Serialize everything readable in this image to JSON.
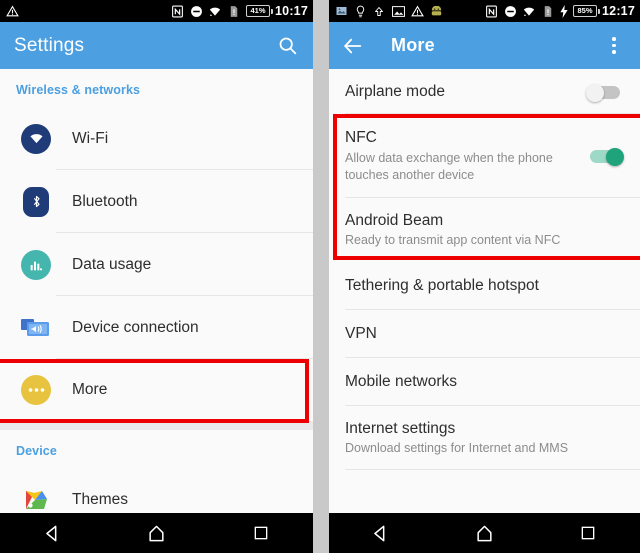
{
  "left_phone": {
    "status_bar": {
      "icons": [
        "warning-triangle-icon",
        "nfc-icon",
        "dnd-icon",
        "wifi-icon",
        "sim-alert-icon"
      ],
      "battery_percent": "41%",
      "clock": "10:17"
    },
    "app_bar": {
      "title": "Settings",
      "search_icon": "search-icon"
    },
    "sections": [
      {
        "header": "Wireless & networks",
        "items": [
          {
            "label": "Wi-Fi",
            "icon": "wifi-icon"
          },
          {
            "label": "Bluetooth",
            "icon": "bluetooth-icon"
          },
          {
            "label": "Data usage",
            "icon": "data-usage-icon"
          },
          {
            "label": "Device connection",
            "icon": "device-connection-icon"
          },
          {
            "label": "More",
            "icon": "more-dots-icon",
            "highlighted": true
          }
        ]
      },
      {
        "header": "Device",
        "items": [
          {
            "label": "Themes",
            "icon": "themes-icon"
          }
        ]
      }
    ]
  },
  "right_phone": {
    "status_bar": {
      "icons": [
        "screenshot-icon",
        "tip-bulb-icon",
        "upload-icon",
        "image-icon",
        "warning-triangle-icon",
        "android-icon",
        "nfc-icon",
        "dnd-icon",
        "wifi-icon",
        "sim-alert-icon",
        "charging-bolt-icon"
      ],
      "battery_percent": "85%",
      "clock": "12:17"
    },
    "app_bar": {
      "back_icon": "back-arrow-icon",
      "title": "More",
      "overflow_icon": "overflow-menu-icon"
    },
    "items": [
      {
        "title": "Airplane mode",
        "subtitle": "",
        "toggle": "off"
      },
      {
        "title": "NFC",
        "subtitle": "Allow data exchange when the phone touches another device",
        "toggle": "on",
        "highlighted": true
      },
      {
        "title": "Android Beam",
        "subtitle": "Ready to transmit app content via NFC",
        "toggle": null,
        "highlighted": true
      },
      {
        "title": "Tethering & portable hotspot",
        "subtitle": "",
        "toggle": null
      },
      {
        "title": "VPN",
        "subtitle": "",
        "toggle": null
      },
      {
        "title": "Mobile networks",
        "subtitle": "",
        "toggle": null
      },
      {
        "title": "Internet settings",
        "subtitle": "Download settings for Internet and MMS",
        "toggle": null
      }
    ]
  },
  "nav_bar": {
    "back": "back-triangle-icon",
    "home": "home-icon",
    "recents": "recents-square-icon"
  },
  "colors": {
    "accent_blue": "#4c9fe0",
    "highlight_red": "#ee0000",
    "toggle_on_green": "#1fa37a",
    "background_gray": "#c9c9c9"
  }
}
